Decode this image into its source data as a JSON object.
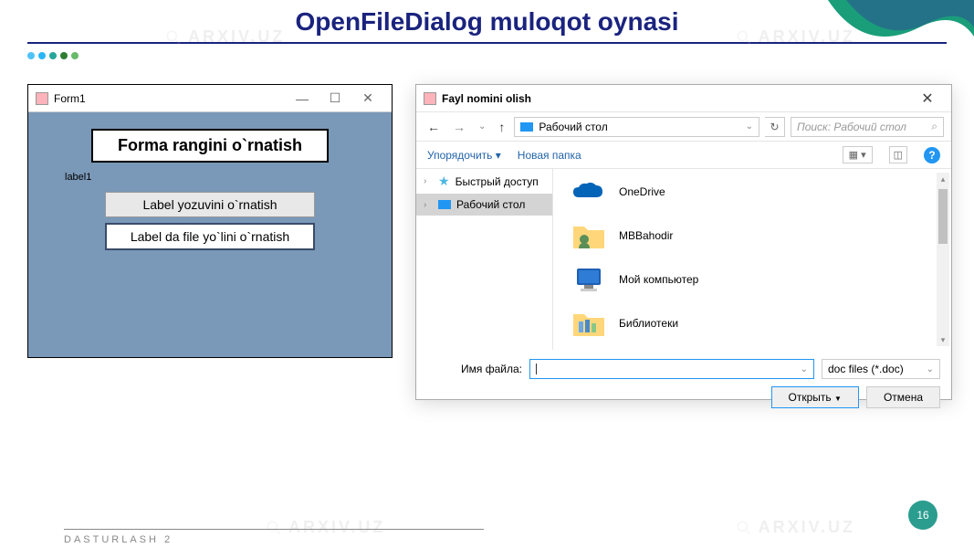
{
  "slide": {
    "title": "OpenFileDialog muloqot oynasi",
    "footer_text": "DASTURLASH 2",
    "page_number": "16"
  },
  "watermark": "ARXIV.UZ",
  "form1": {
    "title": "Form1",
    "button1": "Forma rangini o`rnatish",
    "label1": "label1",
    "button2": "Label yozuvini o`rnatish",
    "button3": "Label da file yo`lini  o`rnatish"
  },
  "dialog": {
    "title": "Fayl nomini olish",
    "path": "Рабочий стол",
    "search_placeholder": "Поиск: Рабочий стол",
    "toolbar": {
      "organize": "Упорядочить",
      "new_folder": "Новая папка"
    },
    "sidebar": {
      "quick": "Быстрый доступ",
      "desktop": "Рабочий стол"
    },
    "files": {
      "onedrive": "OneDrive",
      "user": "MBBahodir",
      "computer": "Мой компьютер",
      "libraries": "Библиотеки"
    },
    "footer": {
      "filename_label": "Имя файла:",
      "filetype": "doc files (*.doc)",
      "open": "Открыть",
      "cancel": "Отмена"
    }
  }
}
